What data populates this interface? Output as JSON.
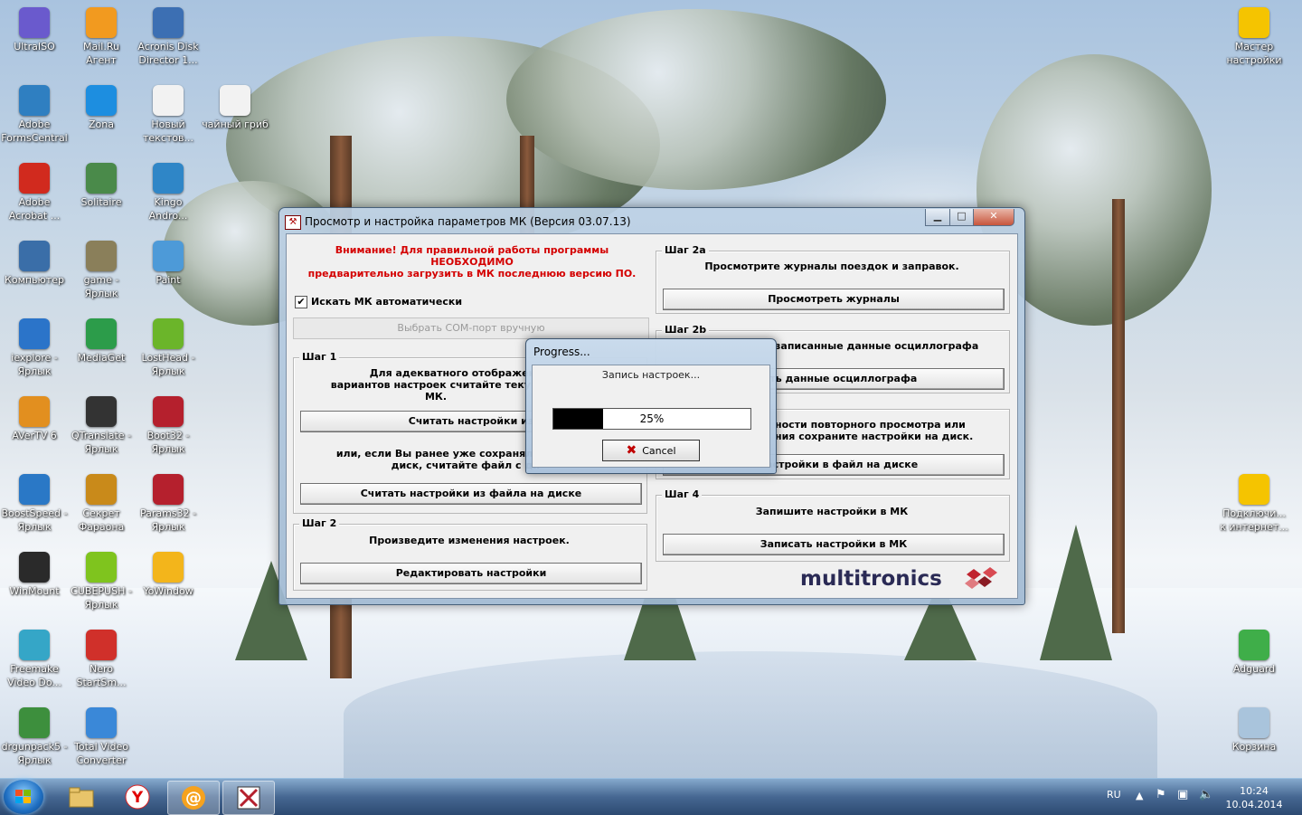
{
  "desktop": {
    "icons_left": [
      {
        "label": "UltraISO",
        "icon": "disc-icon",
        "color": "#6a5acd"
      },
      {
        "label": "Mail.Ru Агент",
        "icon": "mail-agent-icon",
        "color": "#f29a1f"
      },
      {
        "label": "Acronis Disk Director 1...",
        "icon": "acronis-icon",
        "color": "#3c6fb3"
      },
      {
        "label": "Adobe FormsCentral",
        "icon": "adobe-forms-icon",
        "color": "#2f7fc1"
      },
      {
        "label": "Zona",
        "icon": "zona-icon",
        "color": "#1d8ee0"
      },
      {
        "label": "Новый текстов...",
        "icon": "text-file-icon",
        "color": "#f2f2f2"
      },
      {
        "label": "чайный гриб",
        "icon": "text-file-icon",
        "color": "#f2f2f2"
      },
      {
        "label": "Adobe Acrobat ...",
        "icon": "acrobat-icon",
        "color": "#d12a1e"
      },
      {
        "label": "Solitaire",
        "icon": "solitaire-icon",
        "color": "#4a8a4a"
      },
      {
        "label": "Kingo Andro...",
        "icon": "kingo-icon",
        "color": "#2f86c7"
      },
      {
        "label": "Компьютер",
        "icon": "computer-icon",
        "color": "#3a6ea8"
      },
      {
        "label": "game - Ярлык",
        "icon": "game-icon",
        "color": "#8a7f5a"
      },
      {
        "label": "Paint",
        "icon": "paint-icon",
        "color": "#4d9ad8"
      },
      {
        "label": "iexplore - Ярлык",
        "icon": "ie-icon",
        "color": "#2b74c9"
      },
      {
        "label": "MediaGet",
        "icon": "mediaget-icon",
        "color": "#2c9c4a"
      },
      {
        "label": "LostHead - Ярлык",
        "icon": "losthead-icon",
        "color": "#6bb52a"
      },
      {
        "label": "AVerTV 6",
        "icon": "avertv-icon",
        "color": "#e28f1f"
      },
      {
        "label": "QTranslate - Ярлык",
        "icon": "qtranslate-icon",
        "color": "#333333"
      },
      {
        "label": "Boot32 - Ярлык",
        "icon": "boot32-icon",
        "color": "#b5202d"
      },
      {
        "label": "BoostSpeed - Ярлык",
        "icon": "boostspeed-icon",
        "color": "#2a78c6"
      },
      {
        "label": "Секрет Фараона",
        "icon": "pharaoh-icon",
        "color": "#c98a1a"
      },
      {
        "label": "Params32 - Ярлык",
        "icon": "params32-icon",
        "color": "#b5202d"
      },
      {
        "label": "WinMount",
        "icon": "winmount-icon",
        "color": "#2a2a2a"
      },
      {
        "label": "CUBEPUSH - Ярлык",
        "icon": "cubepush-icon",
        "color": "#7fc41e"
      },
      {
        "label": "YoWindow",
        "icon": "yowindow-icon",
        "color": "#f3b51b"
      },
      {
        "label": "Freemake Video Do...",
        "icon": "freemake-icon",
        "color": "#35a6c7"
      },
      {
        "label": "Nero StartSm...",
        "icon": "nero-icon",
        "color": "#d0302a"
      },
      {
        "label": "drgunpack5 - Ярлык",
        "icon": "drgunpack-icon",
        "color": "#3d8f3d"
      },
      {
        "label": "Total Video Converter",
        "icon": "tvc-icon",
        "color": "#3a88d8"
      }
    ],
    "icons_right": [
      {
        "label": "Мастер настройки",
        "icon": "beeline-icon",
        "color": "#f5c400"
      },
      {
        "label": "Подключи... к интернет...",
        "icon": "beeline-icon",
        "color": "#f5c400"
      },
      {
        "label": "Adguard",
        "icon": "adguard-icon",
        "color": "#3fae49"
      },
      {
        "label": "Корзина",
        "icon": "recycle-bin-icon",
        "color": "#a9c4dc"
      }
    ]
  },
  "main_window": {
    "title": "Просмотр и настройка параметров МК (Версия 03.07.13)",
    "warning_line1": "Внимание! Для правильной работы программы",
    "warning_line2": "НЕОБХОДИМО",
    "warning_line3": "предварительно загрузить в МК последнюю версию ПО.",
    "checkbox_label": "Искать МК автоматически",
    "checkbox_checked": true,
    "com_port_button": "Выбрать COM-порт вручную",
    "step1": {
      "legend": "Шаг 1",
      "text1": "Для адекватного отображения",
      "text2": "вариантов настроек считайте теку",
      "text3": "МК.",
      "read_button": "Считать настройки из",
      "text4": "или, если Вы ранее уже сохраняли",
      "text5": "диск, считайте файл с ди",
      "read_file_button": "Считать настройки из файла на диске"
    },
    "step2": {
      "legend": "Шаг 2",
      "text": "Произведите изменения настроек.",
      "button": "Редактировать настройки"
    },
    "step2a": {
      "legend": "Шаг 2a",
      "text": "Просмотрите журналы поездок и заправок.",
      "button": "Просмотреть журналы"
    },
    "step2b": {
      "legend": "Шаг 2b",
      "text": "записанные данные осциллографа",
      "button": "треть данные осциллографа"
    },
    "step3": {
      "text1": "ности повторного просмотра или",
      "text2": "ния сохраните настройки на диск.",
      "button": "ь настройки в файл на диске"
    },
    "step4": {
      "legend": "Шаг 4",
      "text": "Запишите настройки в МК",
      "button": "Записать настройки в МК"
    },
    "logo": "multitronics",
    "logo_color": "#2a2a55",
    "logo_mark_color": "#c0232f"
  },
  "progress_dialog": {
    "title": "Progress...",
    "label": "Запись настроек...",
    "percent_text": "25%",
    "percent": 25,
    "cancel_label": "Cancel"
  },
  "taskbar": {
    "pinned": [
      {
        "name": "explorer",
        "icon": "folder-icon"
      },
      {
        "name": "yandex",
        "icon": "yandex-icon"
      },
      {
        "name": "mail-agent",
        "icon": "mail-agent-icon"
      },
      {
        "name": "params",
        "icon": "params32-icon"
      }
    ],
    "language": "RU",
    "time": "10:24",
    "date": "10.04.2014"
  }
}
